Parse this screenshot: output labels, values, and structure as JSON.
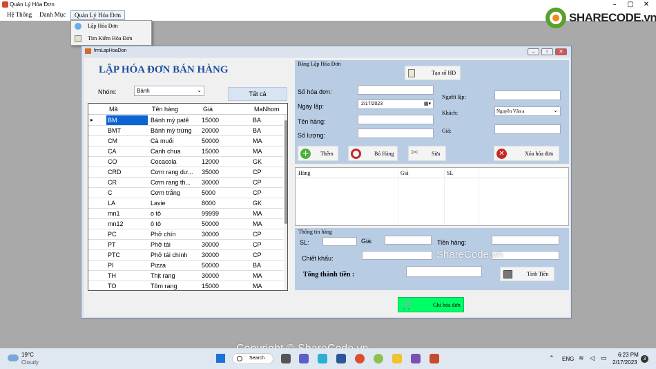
{
  "window": {
    "title": "Quản Lý Hóa Đơn",
    "minimize": "–",
    "maximize": "▢",
    "close": "✕"
  },
  "menu": {
    "items": [
      "Hệ Thống",
      "Danh Mục",
      "Quản Lý Hóa Đơn"
    ],
    "dropdown": [
      "Lập Hóa Đơn",
      "Tìm Kiếm Hóa Đơn"
    ]
  },
  "watermark": {
    "logo": "SHARECODE.vn",
    "center": "ShareCode.vn",
    "bottom": "Copyright © ShareCode.vn"
  },
  "child": {
    "title": "frmLapHoaDon"
  },
  "form": {
    "heading": "LẬP HÓA ĐƠN BÁN HÀNG",
    "group_label": "Nhóm:",
    "group_value": "Bánh",
    "all_button": "Tất cả",
    "grid": {
      "columns": [
        "Mã",
        "Tên hàng",
        "Giá",
        "MaNhom"
      ],
      "rows": [
        [
          "BM",
          "Bánh mỳ patê",
          "15000",
          "BA"
        ],
        [
          "BMT",
          "Bánh mỳ trứng",
          "20000",
          "BA"
        ],
        [
          "CM",
          "Cà muối",
          "50000",
          "MA"
        ],
        [
          "CA",
          "Canh chua",
          "15000",
          "MA"
        ],
        [
          "CO",
          "Cocacola",
          "12000",
          "GK"
        ],
        [
          "CRD",
          "Cơm rang dư...",
          "35000",
          "CP"
        ],
        [
          "CR",
          "Cơm rang th...",
          "30000",
          "CP"
        ],
        [
          "C",
          "Cơm trắng",
          "5000",
          "CP"
        ],
        [
          "LA",
          "Lavie",
          "8000",
          "GK"
        ],
        [
          "mn1",
          "o tô",
          "99999",
          "MA"
        ],
        [
          " mn12",
          "ô tô",
          "50000",
          "MA"
        ],
        [
          "PC",
          "Phở chín",
          "30000",
          "CP"
        ],
        [
          "PT",
          "Phở tái",
          "30000",
          "CP"
        ],
        [
          "PTC",
          "Phở tái chính",
          "30000",
          "CP"
        ],
        [
          "PI",
          "Pizza",
          "50000",
          "BA"
        ],
        [
          "TH",
          "Thịt rang",
          "30000",
          "MA"
        ],
        [
          "TO",
          "Tôm rang",
          "15000",
          "MA"
        ]
      ]
    },
    "bang_lap": {
      "title": "Bảng Lập Hóa Đơn",
      "tao_so_hd": "Tạo số HĐ",
      "so_hoa_don_label": "Số hóa đơn:",
      "so_hoa_don": "",
      "ngay_lap_label": "Ngày lập:",
      "ngay_lap": "2/17/2023",
      "ten_hang_label": "Tên hàng:",
      "ten_hang": "",
      "so_luong_label": "Số lượng:",
      "so_luong": "",
      "nguoi_lap_label": "Người lập:",
      "nguoi_lap": "",
      "khach_label": "Khách:",
      "khach": "Nguyễn Văn a",
      "gia_label": "Giá:",
      "gia": "",
      "them": "Thêm",
      "bo_hang": "Bỏ Hàng",
      "sua": "Sửa",
      "xoa": "Xóa hóa đơn"
    },
    "hang_list": {
      "columns": [
        "Hàng",
        "Giá",
        "SL"
      ]
    },
    "thong_tin": {
      "title": "Thông tin hàng",
      "sl_label": "SL:",
      "gia_label": "Giá:",
      "tien_hang_label": "Tiền hàng:",
      "chiet_khau_label": "Chiết khấu:",
      "tong_label": "Tổng thành tiền :",
      "tinh_tien": "Tính Tiền"
    },
    "ghi_hoa_don": "Ghi hóa đơn"
  },
  "taskbar": {
    "weather_temp": "19°C",
    "weather_desc": "Cloudy",
    "search": "Search",
    "lang": "ENG",
    "time": "6:23 PM",
    "date": "2/17/2023",
    "notif": "3"
  },
  "colors": {
    "heading": "#1c4fa0",
    "panel": "#b8cce4",
    "green_button": "#00ff66",
    "selected": "#0a64d4"
  }
}
